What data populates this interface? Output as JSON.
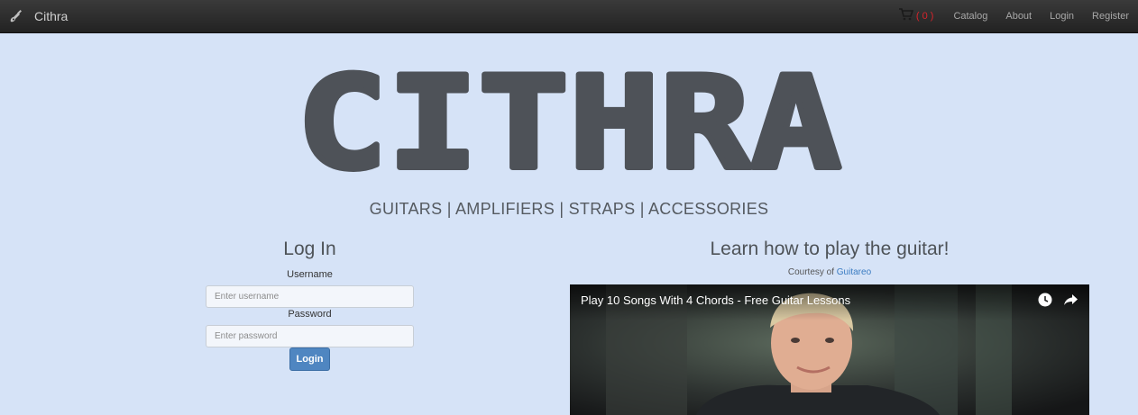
{
  "navbar": {
    "brand_icon": "guitar-icon",
    "brand_label": "Cithra",
    "cart_icon": "cart-icon",
    "cart_count": "( 0 )",
    "links": [
      "Catalog",
      "About",
      "Login",
      "Register"
    ]
  },
  "hero": {
    "logo_text": "CITHRA",
    "tagline": "GUITARS | AMPLIFIERS | STRAPS | ACCESSORIES"
  },
  "login": {
    "title": "Log In",
    "username_label": "Username",
    "username_placeholder": "Enter username",
    "username_value": "",
    "password_label": "Password",
    "password_placeholder": "Enter password",
    "password_value": "",
    "button_label": "Login"
  },
  "video_section": {
    "title": "Learn how to play the guitar!",
    "courtesy_prefix": "Courtesy of",
    "courtesy_link": "Guitareo",
    "video_title": "Play 10 Songs With 4 Chords - Free Guitar Lessons",
    "icons": [
      "watch-later-icon",
      "share-icon"
    ]
  },
  "colors": {
    "background": "#d6e3f7",
    "navbar": "#2b2b2b",
    "logo": "#4e5258",
    "primary_button": "#4f86c1",
    "cart_count": "#d9232b",
    "link": "#3b7cc2"
  }
}
